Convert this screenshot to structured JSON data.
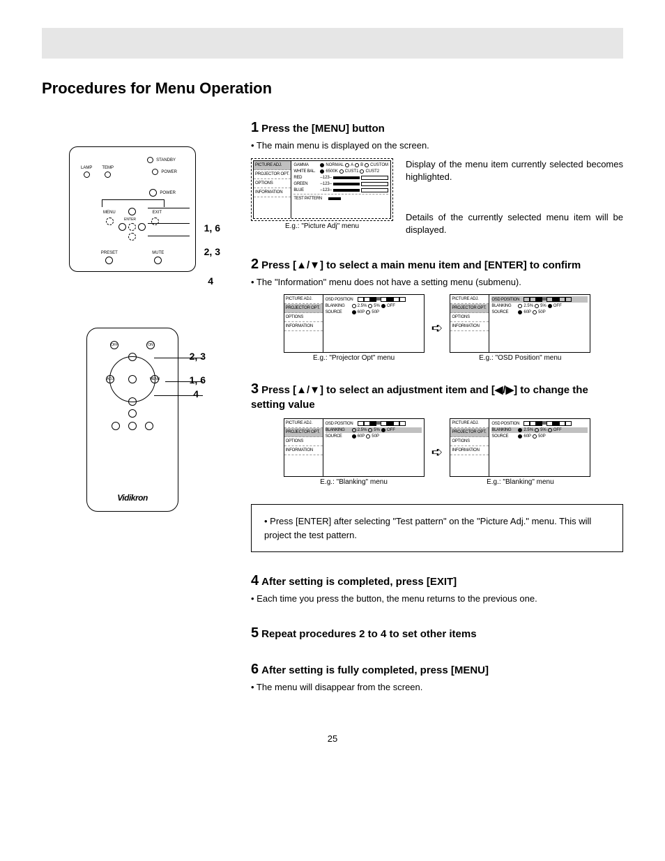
{
  "page_number": "25",
  "section_title": "Procedures for Menu Operation",
  "steps": [
    {
      "num": "1",
      "title": "Press the [MENU] button",
      "body": "• The main menu is displayed on the screen.",
      "annot1": "Display of the menu item currently selected becomes highlighted.",
      "annot2": "Details of the currently selected menu item will be displayed.",
      "caption": "E.g.: \"Picture Adj\" menu"
    },
    {
      "num": "2",
      "title": "Press [▲/▼] to select a main menu item and [ENTER] to confirm",
      "body": "• The \"Information\" menu does not have a setting menu (submenu).",
      "caption_left": "E.g.: \"Projector Opt\" menu",
      "caption_right": "E.g.: \"OSD Position\" menu"
    },
    {
      "num": "3",
      "title": "Press [▲/▼] to select an adjustment item and [◀/▶] to change the setting value",
      "caption_left": "E.g.: \"Blanking\" menu",
      "caption_right": "E.g.: \"Blanking\" menu"
    },
    {
      "num": "4",
      "title": "After setting is completed, press [EXIT]",
      "body": "• Each time you press the button, the menu returns to the previous one."
    },
    {
      "num": "5",
      "title": "Repeat procedures 2 to 4 to set other items"
    },
    {
      "num": "6",
      "title": "After setting is fully completed, press [MENU]",
      "body": "• The menu will disappear from the screen."
    }
  ],
  "note": "• Press [ENTER] after selecting \"Test pattern\" on the \"Picture Adj.\" menu. This will project the test pattern.",
  "menu": {
    "left_items": [
      "PICTURE ADJ.",
      "PROJECTOR OPT.",
      "OPTIONS",
      "INFORMATION"
    ],
    "picture_adj": {
      "gamma_label": "GAMMA",
      "gamma_opts": [
        "NORMAL",
        "A",
        "B",
        "CUSTOM"
      ],
      "wb_label": "WHITE BAL.",
      "wb_opts": [
        "6500K",
        "CUST1",
        "CUST2"
      ],
      "colors": [
        "RED",
        "GREEN",
        "BLUE"
      ],
      "color_val": "–123–",
      "test": "TEST PATTERN"
    },
    "projector_opt": {
      "osd_label": "OSD POSITION",
      "blanking_label": "BLANKING",
      "blanking_opts": [
        "2.5%",
        "5%",
        "OFF"
      ],
      "source_label": "SOURCE",
      "source_opts": [
        "60P",
        "50P"
      ]
    }
  },
  "device": {
    "top_row": [
      "LAMP",
      "TEMP",
      "STANDBY",
      "POWER"
    ],
    "power_btn": "POWER",
    "nav": [
      "MENU",
      "EXIT",
      "ENTER"
    ],
    "bottom": [
      "PRESET",
      "MUTE"
    ],
    "callout_16": "1, 6",
    "callout_23": "2, 3",
    "callout_4": "4"
  },
  "remote": {
    "top": [
      "OFF",
      "ON"
    ],
    "nav": [
      "ADJ",
      "MENU"
    ],
    "callout_23": "2, 3",
    "callout_16": "1, 6",
    "callout_4": "4",
    "logo": "Vidikron"
  }
}
